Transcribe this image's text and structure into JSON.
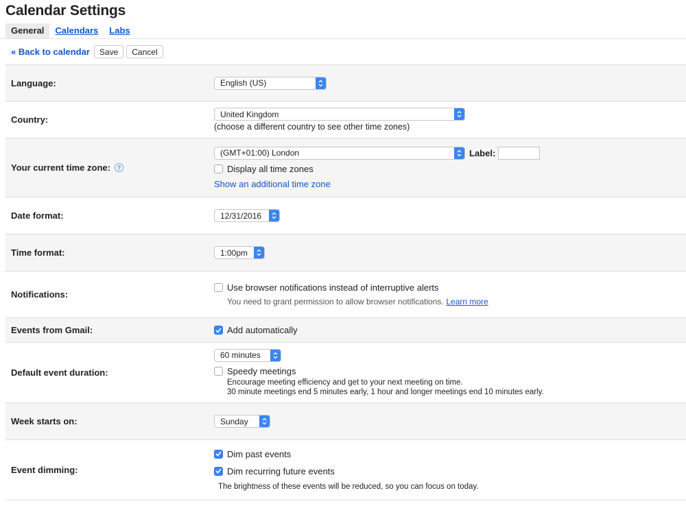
{
  "page": {
    "title": "Calendar Settings"
  },
  "tabs": [
    {
      "label": "General",
      "active": true
    },
    {
      "label": "Calendars",
      "active": false
    },
    {
      "label": "Labs",
      "active": false
    }
  ],
  "toolbar": {
    "back_label": "« Back to calendar",
    "save_label": "Save",
    "cancel_label": "Cancel"
  },
  "settings": {
    "language": {
      "label": "Language:",
      "value": "English (US)"
    },
    "country": {
      "label": "Country:",
      "value": "United Kingdom",
      "hint": "(choose a different country to see other time zones)"
    },
    "timezone": {
      "label": "Your current time zone:",
      "value": "(GMT+01:00) London",
      "label_field_label": "Label:",
      "label_field_value": "",
      "display_all_label": "Display all time zones",
      "display_all_checked": false,
      "additional_link": "Show an additional time zone"
    },
    "date_format": {
      "label": "Date format:",
      "value": "12/31/2016"
    },
    "time_format": {
      "label": "Time format:",
      "value": "1:00pm"
    },
    "notifications": {
      "label": "Notifications:",
      "option_label": "Use browser notifications instead of interruptive alerts",
      "checked": false,
      "hint": "You need to grant permission to allow browser notifications.",
      "learn_more": "Learn more"
    },
    "events_from_gmail": {
      "label": "Events from Gmail:",
      "option_label": "Add automatically",
      "checked": true
    },
    "default_duration": {
      "label": "Default event duration:",
      "value": "60 minutes",
      "speedy_label": "Speedy meetings",
      "speedy_checked": false,
      "desc_line1": "Encourage meeting efficiency and get to your next meeting on time.",
      "desc_line2": "30 minute meetings end 5 minutes early, 1 hour and longer meetings end 10 minutes early."
    },
    "week_starts": {
      "label": "Week starts on:",
      "value": "Sunday"
    },
    "event_dimming": {
      "label": "Event dimming:",
      "past_label": "Dim past events",
      "past_checked": true,
      "recurring_label": "Dim recurring future events",
      "recurring_checked": true,
      "desc": "The brightness of these events will be reduced, so you can focus on today."
    }
  },
  "colors": {
    "accent": "#3a86f0",
    "link": "#1155cc",
    "row_bg": "#f5f5f5",
    "border": "#dcdcdc"
  }
}
